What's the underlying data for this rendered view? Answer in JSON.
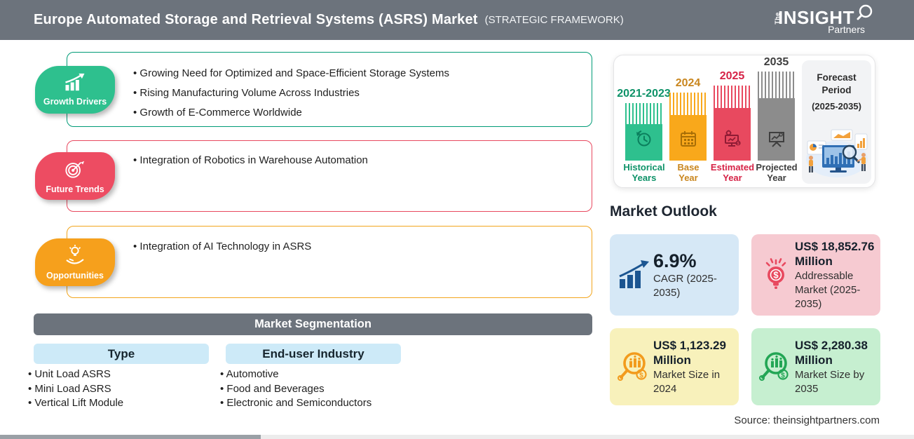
{
  "header": {
    "title": "Europe Automated Storage and Retrieval Systems (ASRS) Market",
    "subtitle": "(STRATEGIC FRAMEWORK)",
    "logo": {
      "the": "The",
      "insight": "INSIGHT",
      "partners": "Partners"
    }
  },
  "framework": {
    "growth_drivers": {
      "label": "Growth Drivers",
      "badge_color": "#2EC08E",
      "border_color": "#009B77",
      "items": [
        "Growing Need for Optimized and Space-Efficient Storage Systems",
        "Rising Manufacturing Volume Across Industries",
        "Growth of E-Commerce Worldwide"
      ]
    },
    "future_trends": {
      "label": "Future Trends",
      "badge_color": "#ED4C62",
      "border_color": "#E8495F",
      "items": [
        "Integration of Robotics in Warehouse Automation"
      ]
    },
    "opportunities": {
      "label": "Opportunities",
      "badge_color": "#F6A01C",
      "border_color": "#F2A51C",
      "items": [
        "Integration of AI Technology in ASRS"
      ]
    }
  },
  "segmentation": {
    "title": "Market Segmentation",
    "columns": [
      {
        "header": "Type",
        "items": [
          "Unit Load ASRS",
          "Mini Load ASRS",
          "Vertical Lift Module"
        ]
      },
      {
        "header": "End-user Industry",
        "items": [
          "Automotive",
          "Food and Beverages",
          "Electronic and Semiconductors"
        ]
      }
    ]
  },
  "timeline": {
    "bars": [
      {
        "year": "2021-2023",
        "label_line1": "Historical",
        "label_line2": "Years",
        "color": "#2EC08E",
        "text_color": "#0D9268",
        "icon": "clock-history-icon"
      },
      {
        "year": "2024",
        "label_line1": "Base",
        "label_line2": "Year",
        "color": "#F9A81B",
        "text_color": "#C9861E",
        "icon": "calendar-icon"
      },
      {
        "year": "2025",
        "label_line1": "Estimated",
        "label_line2": "Year",
        "color": "#E8495F",
        "text_color": "#D62246",
        "icon": "monitor-gear-icon"
      },
      {
        "year": "2035",
        "label_line1": "Projected",
        "label_line2": "Year",
        "color": "#8C8C8C",
        "text_color": "#3E3E3E",
        "icon": "presentation-screen-icon"
      }
    ],
    "forecast": {
      "line1": "Forecast",
      "line2": "Period",
      "range": "(2025-2035)"
    }
  },
  "outlook": {
    "title": "Market Outlook",
    "cards": [
      {
        "value": "6.9%",
        "label": "CAGR (2025-2035)",
        "bg": "#D6E8F6",
        "icon": "growth-arrow-chart-icon",
        "icon_color": "#1B5591"
      },
      {
        "value": "US$ 18,852.76 Million",
        "label": "Addressable Market (2025-2035)",
        "bg": "#F6CAD1",
        "icon": "bulb-dollar-icon",
        "icon_color": "#E8495F"
      },
      {
        "value": "US$ 1,123.29 Million",
        "label": "Market Size in 2024",
        "bg": "#F8F1BB",
        "icon": "magnifier-chart-dollar-icon",
        "icon_color": "#F29B1D"
      },
      {
        "value": "US$ 2,280.38 Million",
        "label": "Market Size by 2035",
        "bg": "#C6EFD0",
        "icon": "magnifier-chart-dollar-icon",
        "icon_color": "#23A655"
      }
    ]
  },
  "source": "Source: theinsightpartners.com"
}
